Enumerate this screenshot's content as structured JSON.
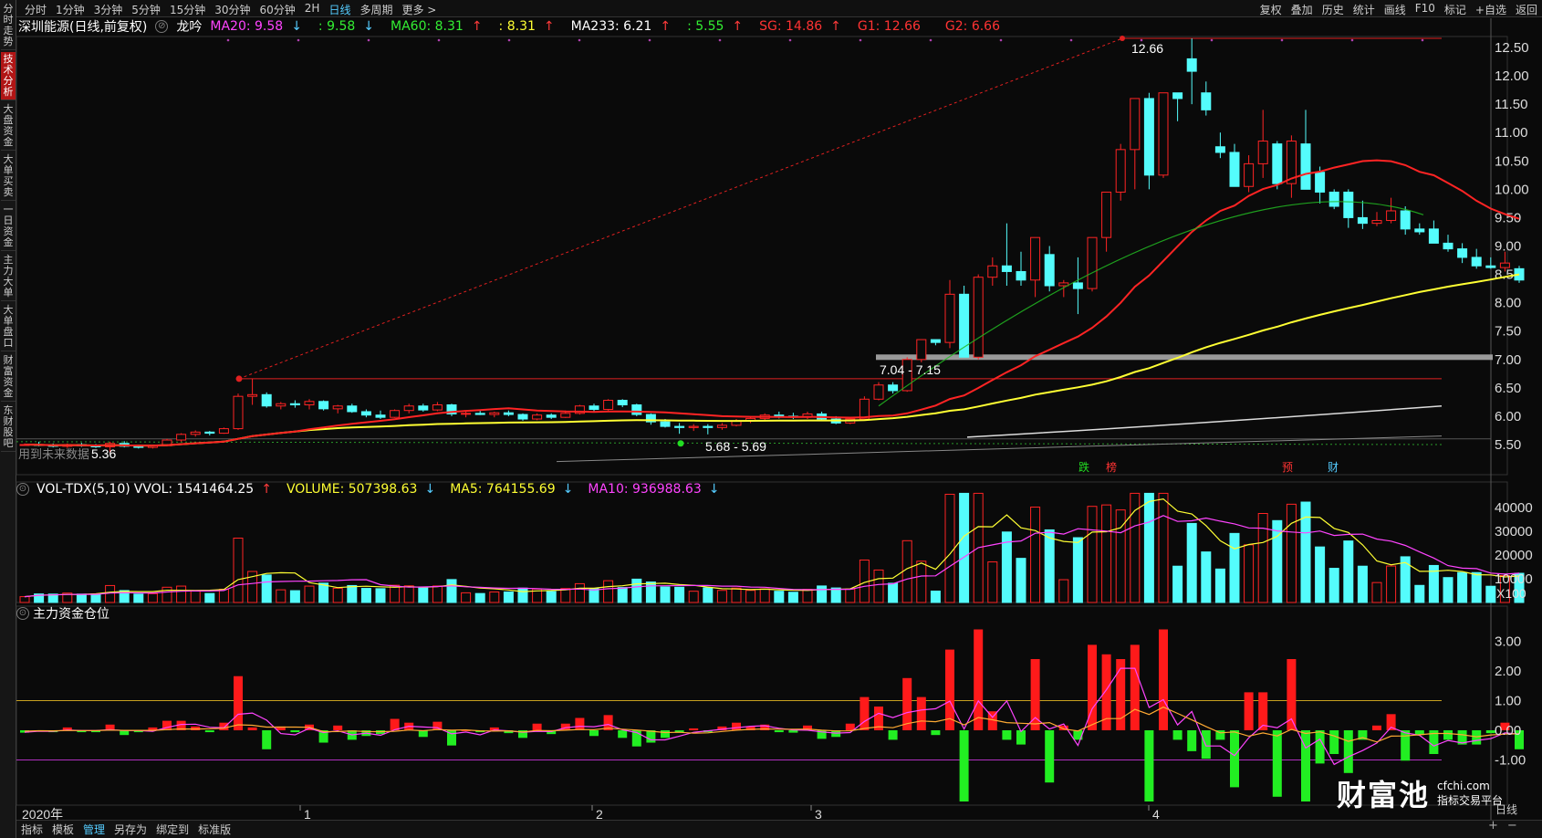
{
  "sidebar": {
    "tabs": [
      {
        "label": "分时走势",
        "active": false
      },
      {
        "label": "技术分析",
        "active": true
      },
      {
        "label": "大盘资金",
        "active": false
      },
      {
        "label": "大单买卖",
        "active": false
      },
      {
        "label": "一日资金",
        "active": false
      },
      {
        "label": "主力大单",
        "active": false
      },
      {
        "label": "大单盘口",
        "active": false
      },
      {
        "label": "财富资金",
        "active": false
      },
      {
        "label": "东财股吧",
        "active": false
      }
    ]
  },
  "toolbar": {
    "periods": [
      {
        "label": "分时",
        "active": false
      },
      {
        "label": "1分钟",
        "active": false
      },
      {
        "label": "3分钟",
        "active": false
      },
      {
        "label": "5分钟",
        "active": false
      },
      {
        "label": "15分钟",
        "active": false
      },
      {
        "label": "30分钟",
        "active": false
      },
      {
        "label": "60分钟",
        "active": false
      },
      {
        "label": "2H",
        "active": false
      },
      {
        "label": "日线",
        "active": true
      },
      {
        "label": "多周期",
        "active": false
      },
      {
        "label": "更多 >",
        "active": false
      }
    ],
    "tools": [
      "复权",
      "叠加",
      "历史",
      "统计",
      "画线",
      "F10",
      "标记",
      "+自选",
      "返回"
    ]
  },
  "legend": {
    "title": "深圳能源(日线,前复权)",
    "indicator_name": "龙吟",
    "items": [
      {
        "label": "MA20: 9.58",
        "arrow": "↓",
        "color": "#ff44ff"
      },
      {
        "label": ": 9.58",
        "arrow": "↓",
        "color": "#33ee33"
      },
      {
        "label": "MA60: 8.31",
        "arrow": "↑",
        "color": "#33ee33"
      },
      {
        "label": ": 8.31",
        "arrow": "↑",
        "color": "#ffff33"
      },
      {
        "label": "MA233: 6.21",
        "arrow": "↑",
        "color": "#ffffff"
      },
      {
        "label": ": 5.55",
        "arrow": "↑",
        "color": "#33ee33"
      },
      {
        "label": "SG: 14.86",
        "arrow": "↑",
        "color": "#ff3333"
      },
      {
        "label": "G1: 12.66",
        "arrow": "",
        "color": "#ff3333"
      },
      {
        "label": "G2: 6.66",
        "arrow": "",
        "color": "#ff3333"
      }
    ]
  },
  "price_axis": {
    "ticks": [
      "12.50",
      "12.00",
      "11.50",
      "11.00",
      "10.50",
      "10.00",
      "9.50",
      "9.00",
      "8.50",
      "8.00",
      "7.50",
      "7.00",
      "6.50",
      "6.00",
      "5.50"
    ]
  },
  "annotations": {
    "high": "12.66",
    "low": "5.36",
    "low_range": "5.68 - 5.69",
    "zone": "7.04 - 7.15",
    "watermark": "用到未来数据",
    "event_markers": [
      "跌",
      "榜",
      "预",
      "财"
    ]
  },
  "volume": {
    "title": "VOL-TDX(5,10)",
    "items": [
      {
        "label": "VVOL: 1541464.25",
        "arrow": "↑",
        "color": "#ffffff"
      },
      {
        "label": "VOLUME: 507398.63",
        "arrow": "↓",
        "color": "#ffff33"
      },
      {
        "label": "MA5: 764155.69",
        "arrow": "↓",
        "color": "#ffff33"
      },
      {
        "label": "MA10: 936988.63",
        "arrow": "↓",
        "color": "#ff44ff"
      }
    ],
    "ticks": [
      "40000",
      "30000",
      "20000",
      "10000"
    ],
    "unit": "X100"
  },
  "indicator": {
    "title": "主力资金仓位",
    "ticks": [
      "3.00",
      "2.00",
      "1.00",
      "0.00",
      "-1.00"
    ]
  },
  "time_axis": {
    "year": "2020年",
    "months": [
      "1",
      "2",
      "3",
      "4"
    ]
  },
  "bottombar": {
    "items": [
      {
        "label": "指标",
        "active": false
      },
      {
        "label": "模板",
        "active": false
      },
      {
        "label": "管理",
        "active": true
      },
      {
        "label": "另存为",
        "active": false
      },
      {
        "label": "绑定到",
        "active": false
      },
      {
        "label": "标准版",
        "active": false
      }
    ]
  },
  "brand": {
    "big": "财富池",
    "site": "cfchi.com",
    "slogan": "指标交易平台"
  },
  "period_label": "日线",
  "zoom": {
    "plus": "+",
    "minus": "−"
  },
  "colors": {
    "up": "#ff2424",
    "down": "#54fcfc",
    "ma20": "#ff2424",
    "ma60": "#ffff33",
    "ma233": "#dddddd",
    "zone": "#888888"
  },
  "chart_data": {
    "type": "candlestick",
    "candles": [
      [
        5.5,
        5.52,
        5.48,
        5.5
      ],
      [
        5.5,
        5.55,
        5.47,
        5.49
      ],
      [
        5.49,
        5.52,
        5.45,
        5.47
      ],
      [
        5.47,
        5.52,
        5.44,
        5.5
      ],
      [
        5.5,
        5.53,
        5.46,
        5.48
      ],
      [
        5.48,
        5.51,
        5.44,
        5.46
      ],
      [
        5.46,
        5.55,
        5.36,
        5.52
      ],
      [
        5.52,
        5.56,
        5.45,
        5.47
      ],
      [
        5.47,
        5.5,
        5.43,
        5.45
      ],
      [
        5.45,
        5.5,
        5.43,
        5.48
      ],
      [
        5.48,
        5.6,
        5.47,
        5.58
      ],
      [
        5.58,
        5.7,
        5.55,
        5.68
      ],
      [
        5.68,
        5.75,
        5.64,
        5.72
      ],
      [
        5.72,
        5.74,
        5.66,
        5.7
      ],
      [
        5.7,
        5.8,
        5.69,
        5.78
      ],
      [
        5.78,
        6.4,
        5.76,
        6.35
      ],
      [
        6.35,
        6.66,
        6.2,
        6.38
      ],
      [
        6.38,
        6.42,
        6.15,
        6.18
      ],
      [
        6.18,
        6.25,
        6.12,
        6.22
      ],
      [
        6.22,
        6.28,
        6.15,
        6.2
      ],
      [
        6.2,
        6.3,
        6.12,
        6.26
      ],
      [
        6.26,
        6.28,
        6.1,
        6.13
      ],
      [
        6.13,
        6.2,
        6.05,
        6.18
      ],
      [
        6.18,
        6.22,
        6.06,
        6.08
      ],
      [
        6.08,
        6.12,
        5.98,
        6.02
      ],
      [
        6.02,
        6.1,
        5.95,
        5.98
      ],
      [
        5.98,
        6.12,
        5.97,
        6.1
      ],
      [
        6.1,
        6.22,
        6.05,
        6.18
      ],
      [
        6.18,
        6.22,
        6.08,
        6.11
      ],
      [
        6.11,
        6.25,
        6.09,
        6.2
      ],
      [
        6.2,
        6.22,
        6.0,
        6.04
      ],
      [
        6.04,
        6.08,
        5.98,
        6.05
      ],
      [
        6.05,
        6.1,
        6.02,
        6.03
      ],
      [
        6.03,
        6.08,
        5.98,
        6.06
      ],
      [
        6.06,
        6.1,
        6.0,
        6.03
      ],
      [
        6.03,
        6.05,
        5.92,
        5.95
      ],
      [
        5.95,
        6.05,
        5.93,
        6.02
      ],
      [
        6.02,
        6.05,
        5.95,
        5.98
      ],
      [
        5.98,
        6.1,
        5.97,
        6.05
      ],
      [
        6.05,
        6.2,
        6.03,
        6.18
      ],
      [
        6.18,
        6.22,
        6.08,
        6.12
      ],
      [
        6.12,
        6.3,
        6.1,
        6.28
      ],
      [
        6.28,
        6.3,
        6.16,
        6.2
      ],
      [
        6.2,
        6.22,
        6.0,
        6.03
      ],
      [
        6.03,
        6.05,
        5.85,
        5.9
      ],
      [
        5.9,
        5.95,
        5.8,
        5.82
      ],
      [
        5.82,
        5.88,
        5.69,
        5.8
      ],
      [
        5.8,
        5.86,
        5.74,
        5.82
      ],
      [
        5.82,
        5.86,
        5.68,
        5.8
      ],
      [
        5.8,
        5.88,
        5.76,
        5.84
      ],
      [
        5.84,
        5.95,
        5.82,
        5.92
      ],
      [
        5.92,
        6.0,
        5.88,
        5.96
      ],
      [
        5.96,
        6.05,
        5.92,
        6.02
      ],
      [
        6.02,
        6.08,
        5.96,
        6.0
      ],
      [
        6.0,
        6.06,
        5.95,
        5.99
      ],
      [
        5.99,
        6.08,
        5.95,
        6.04
      ],
      [
        6.04,
        6.08,
        5.92,
        5.95
      ],
      [
        5.95,
        6.0,
        5.86,
        5.88
      ],
      [
        5.88,
        5.98,
        5.86,
        5.95
      ],
      [
        5.95,
        6.35,
        5.93,
        6.3
      ],
      [
        6.3,
        6.6,
        6.28,
        6.55
      ],
      [
        6.55,
        6.6,
        6.4,
        6.45
      ],
      [
        6.45,
        7.04,
        6.43,
        7.0
      ],
      [
        7.0,
        7.35,
        6.95,
        7.35
      ],
      [
        7.35,
        7.35,
        7.25,
        7.3
      ],
      [
        7.3,
        8.4,
        7.2,
        8.15
      ],
      [
        8.15,
        8.3,
        7.04,
        7.04
      ],
      [
        7.04,
        8.5,
        7.0,
        8.45
      ],
      [
        8.45,
        8.8,
        8.3,
        8.65
      ],
      [
        8.65,
        9.4,
        8.3,
        8.55
      ],
      [
        8.55,
        8.9,
        8.3,
        8.4
      ],
      [
        8.4,
        9.15,
        8.1,
        9.15
      ],
      [
        8.85,
        9.0,
        8.2,
        8.3
      ],
      [
        8.3,
        8.4,
        8.1,
        8.35
      ],
      [
        8.35,
        8.8,
        7.8,
        8.25
      ],
      [
        8.25,
        9.15,
        8.2,
        9.15
      ],
      [
        9.15,
        9.95,
        8.9,
        9.95
      ],
      [
        9.95,
        10.8,
        9.8,
        10.7
      ],
      [
        10.7,
        11.6,
        10.0,
        11.6
      ],
      [
        11.6,
        11.7,
        10.0,
        10.25
      ],
      [
        10.25,
        11.7,
        10.2,
        11.7
      ],
      [
        11.7,
        11.7,
        11.2,
        11.6
      ],
      [
        12.3,
        12.66,
        11.5,
        12.08
      ],
      [
        11.7,
        11.9,
        11.3,
        11.4
      ],
      [
        10.75,
        11.0,
        10.55,
        10.65
      ],
      [
        10.65,
        10.8,
        10.1,
        10.05
      ],
      [
        10.05,
        10.6,
        9.95,
        10.45
      ],
      [
        10.45,
        11.4,
        10.2,
        10.85
      ],
      [
        10.8,
        10.85,
        10.0,
        10.1
      ],
      [
        10.1,
        10.95,
        9.85,
        10.85
      ],
      [
        10.8,
        11.4,
        10.3,
        10.0
      ],
      [
        10.3,
        10.4,
        9.75,
        9.95
      ],
      [
        9.95,
        10.0,
        9.65,
        9.7
      ],
      [
        9.95,
        10.0,
        9.32,
        9.5
      ],
      [
        9.5,
        9.8,
        9.3,
        9.4
      ],
      [
        9.4,
        9.6,
        9.35,
        9.45
      ],
      [
        9.45,
        9.85,
        9.4,
        9.62
      ],
      [
        9.62,
        9.7,
        9.2,
        9.3
      ],
      [
        9.3,
        9.4,
        9.2,
        9.25
      ],
      [
        9.3,
        9.45,
        9.05,
        9.05
      ],
      [
        9.05,
        9.2,
        8.9,
        8.95
      ],
      [
        8.95,
        9.05,
        8.7,
        8.8
      ],
      [
        8.8,
        8.95,
        8.6,
        8.65
      ],
      [
        8.65,
        8.8,
        8.6,
        8.62
      ],
      [
        8.62,
        8.9,
        8.55,
        8.7
      ],
      [
        8.6,
        8.65,
        8.35,
        8.4
      ]
    ]
  }
}
